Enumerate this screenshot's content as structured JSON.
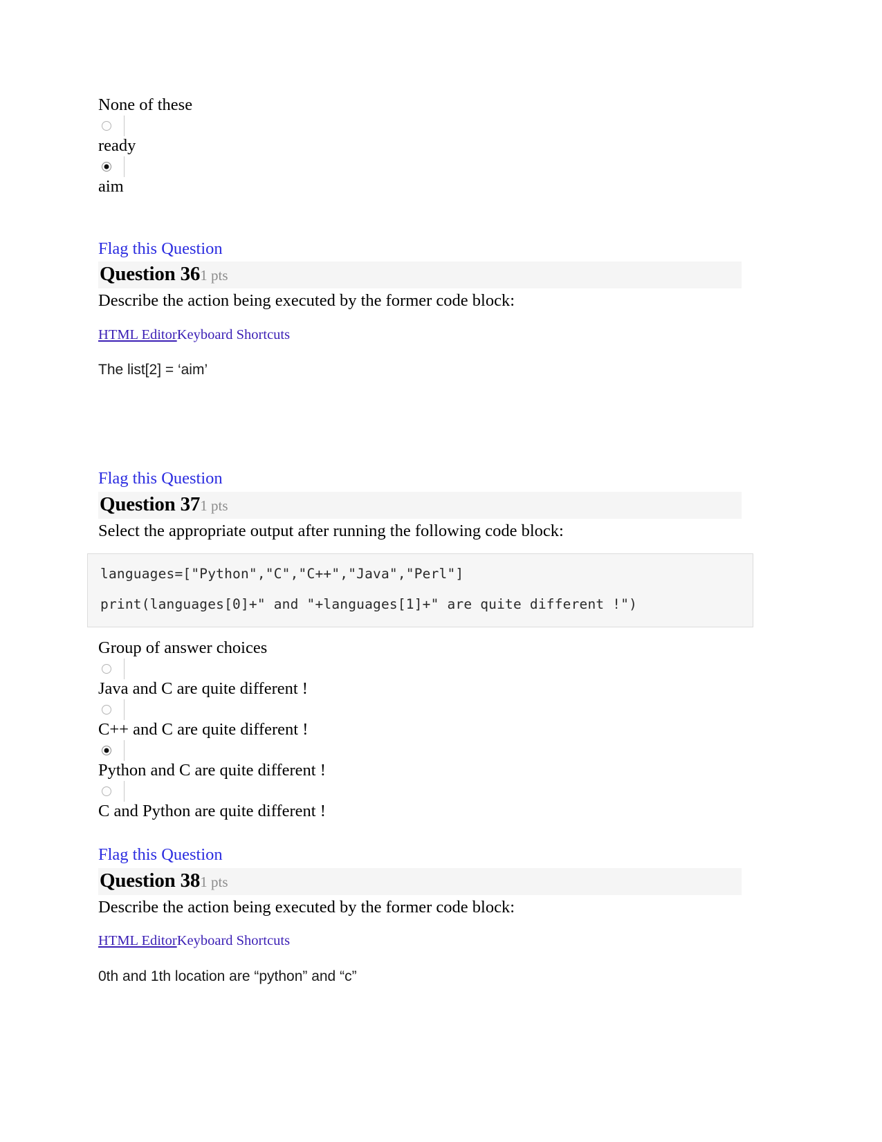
{
  "top_question_tail": {
    "lead_label": "None of these",
    "options": [
      {
        "label": "ready",
        "selected": false
      },
      {
        "label": "aim",
        "selected": true
      }
    ]
  },
  "common": {
    "flag_label": "Flag this Question",
    "html_editor_label": "HTML Editor",
    "keyboard_shortcuts_label": "Keyboard Shortcuts",
    "group_label": "Group of answer choices",
    "points_label": "1 pts"
  },
  "questions": [
    {
      "title": "Question 36",
      "points": "1 pts",
      "prompt": "Describe the action being executed by the former code block:",
      "answer_text": "The list[2] = ‘aim’"
    },
    {
      "title": "Question 37",
      "points": "1 pts",
      "prompt": "Select the appropriate output after running the following code block:",
      "code_lines": [
        "languages=[\"Python\",\"C\",\"C++\",\"Java\",\"Perl\"]",
        "print(languages[0]+\" and \"+languages[1]+\" are quite different !\")"
      ],
      "group_label": "Group of answer choices",
      "options": [
        {
          "label": "Java and C are quite different !",
          "selected": false
        },
        {
          "label": "C++ and C are quite different !",
          "selected": false
        },
        {
          "label": "Python and C are quite different !",
          "selected": true
        },
        {
          "label": "C and Python are quite different !",
          "selected": false
        }
      ]
    },
    {
      "title": "Question 38",
      "points": "1 pts",
      "prompt": "Describe the action being executed by the former code block:",
      "answer_text": "0th and 1th location are “python” and “c”"
    }
  ],
  "colors": {
    "flag_link": "#2b2ce0",
    "editor_link": "#3b1fb5",
    "header_bar": "#f5f5f5",
    "points_gray": "#8c8c8c",
    "code_bg": "#f6f6f6",
    "code_border": "#dcdcdc"
  }
}
